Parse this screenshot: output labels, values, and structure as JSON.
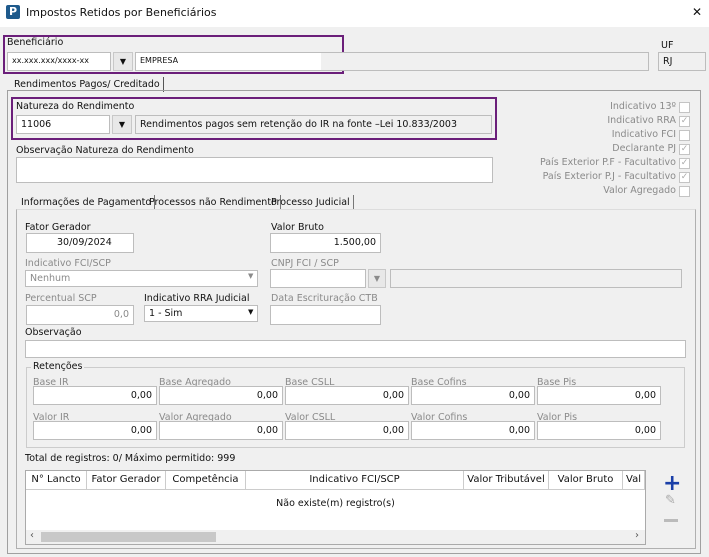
{
  "window": {
    "title": "Impostos Retidos por Beneficiários",
    "close": "✕"
  },
  "beneficiario": {
    "label": "Beneficiário",
    "doc": "xx.xxx.xxx/xxxx-xx",
    "name": "EMPRESA",
    "uf_label": "UF",
    "uf": "RJ"
  },
  "outer_tab": "Rendimentos Pagos/ Creditado",
  "natureza": {
    "label": "Natureza do Rendimento",
    "code": "11006",
    "desc": "Rendimentos pagos sem retenção do IR na fonte –Lei 10.833/2003"
  },
  "obs_natureza_label": "Observação Natureza do Rendimento",
  "checks": [
    {
      "label": "Indicativo 13º",
      "checked": false
    },
    {
      "label": "Indicativo RRA",
      "checked": true
    },
    {
      "label": "Indicativo FCI",
      "checked": false
    },
    {
      "label": "Declarante PJ",
      "checked": true
    },
    {
      "label": "País Exterior P.F - Facultativo",
      "checked": true
    },
    {
      "label": "País Exterior P.J - Facultativo",
      "checked": true
    },
    {
      "label": "Valor Agregado",
      "checked": false
    }
  ],
  "tabs": [
    "Informações de Pagamento",
    "Processos não Rendimento",
    "Processo Judicial"
  ],
  "form": {
    "fator_gerador_label": "Fator Gerador",
    "fator_gerador": "30/09/2024",
    "valor_bruto_label": "Valor Bruto",
    "valor_bruto": "1.500,00",
    "ind_fci_label": "Indicativo FCI/SCP",
    "ind_fci": "Nenhum",
    "cnpj_fci_label": "CNPJ FCI / SCP",
    "percentual_label": "Percentual SCP",
    "percentual": "0,0",
    "rra_label": "Indicativo RRA Judicial",
    "rra": "1 - Sim",
    "data_ctb_label": "Data Escrituração CTB",
    "obs_label": "Observação"
  },
  "retencoes": {
    "title": "Retenções",
    "base": [
      {
        "label": "Base IR",
        "value": "0,00"
      },
      {
        "label": "Base Agregado",
        "value": "0,00"
      },
      {
        "label": "Base CSLL",
        "value": "0,00"
      },
      {
        "label": "Base Cofins",
        "value": "0,00"
      },
      {
        "label": "Base Pis",
        "value": "0,00"
      }
    ],
    "valor": [
      {
        "label": "Valor IR",
        "value": "0,00"
      },
      {
        "label": "Valor Agregado",
        "value": "0,00"
      },
      {
        "label": "Valor CSLL",
        "value": "0,00"
      },
      {
        "label": "Valor Cofins",
        "value": "0,00"
      },
      {
        "label": "Valor Pis",
        "value": "0,00"
      }
    ]
  },
  "grid": {
    "total": "Total de registros: 0/ Máximo permitido: 999",
    "columns": [
      "N° Lancto",
      "Fator Gerador",
      "Competência",
      "Indicativo FCI/SCP",
      "Valor Tributável",
      "Valor Bruto",
      "Val"
    ],
    "empty": "Não existe(m) registro(s)"
  },
  "colors": {
    "accent": "#6b1f7a",
    "add": "#1a3fa8"
  }
}
